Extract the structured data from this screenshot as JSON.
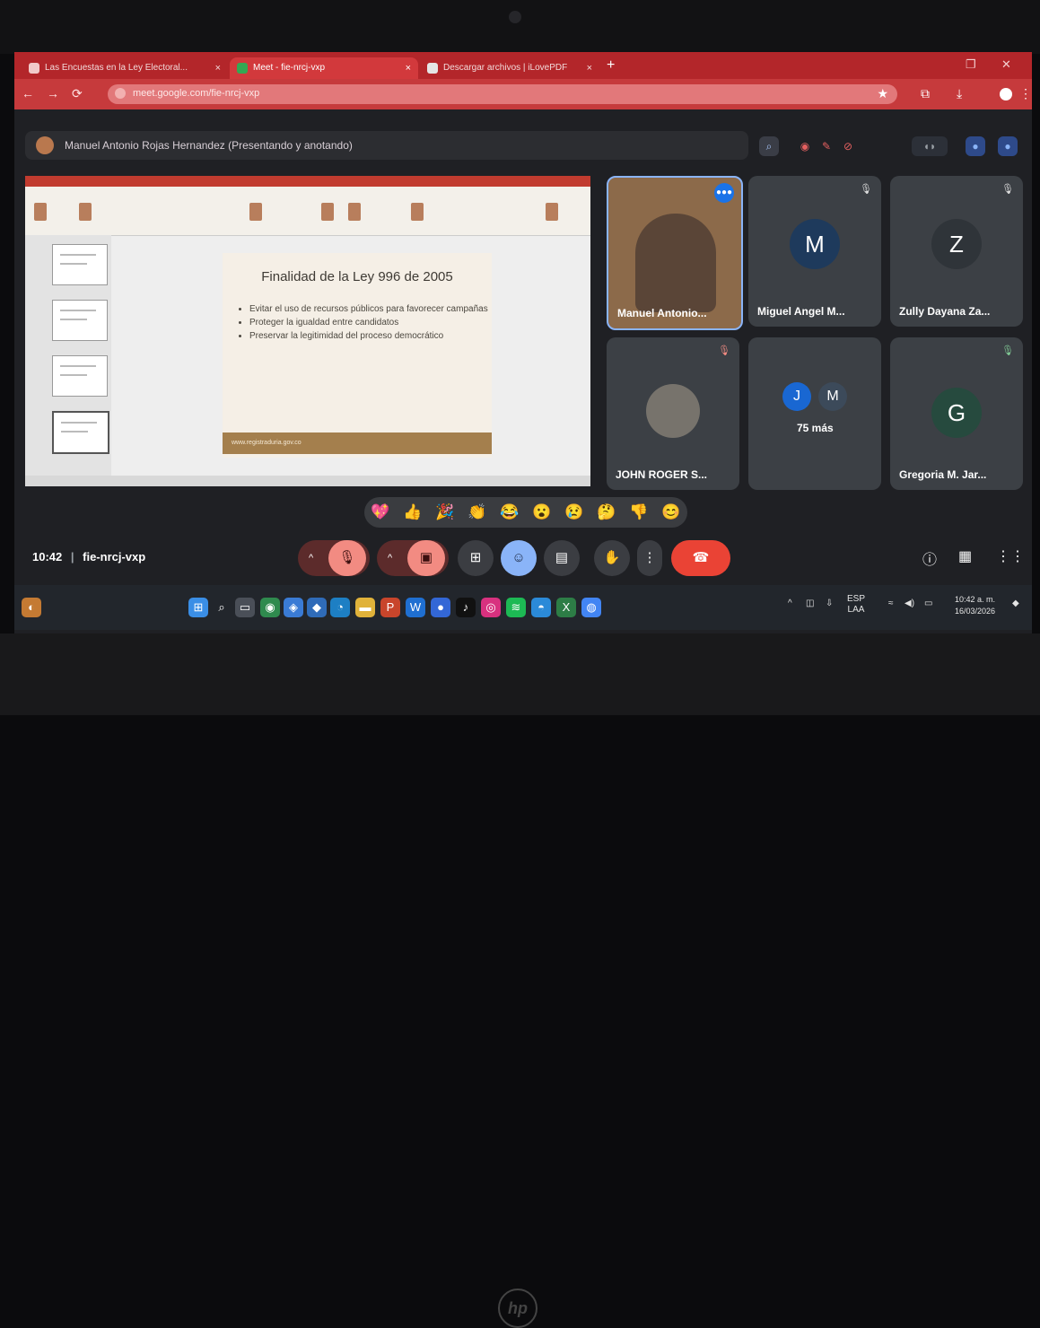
{
  "browser": {
    "tabs": [
      {
        "label": "Las Encuestas en la Ley Electoral...",
        "close": "×"
      },
      {
        "label": "Meet - fie-nrcj-vxp",
        "close": "×"
      },
      {
        "label": "Descargar archivos | iLovePDF",
        "close": "×"
      }
    ],
    "new_tab": "+",
    "url": "meet.google.com/fie-nrcj-vxp"
  },
  "meet": {
    "presenter_text": "Manuel Antonio Rojas Hernandez (Presentando y anotando)",
    "slide": {
      "title": "Finalidad de la Ley 996 de 2005",
      "bullets": [
        "Evitar el uso de recursos públicos para favorecer campañas",
        "Proteger la igualdad entre candidatos",
        "Preservar la legitimidad del proceso democrático"
      ],
      "footer": "www.registraduria.gov.co"
    },
    "participants": [
      {
        "name": "Manuel Antonio..."
      },
      {
        "name": "Miguel Angel M...",
        "initial": "M",
        "color": "#1e3a5c"
      },
      {
        "name": "Zully Dayana Za...",
        "initial": "Z",
        "color": "#2f3439"
      },
      {
        "name": "JOHN ROGER S..."
      },
      {
        "name": "Gregoria M. Jar...",
        "initial": "G",
        "color": "#264a3e"
      }
    ],
    "more": {
      "initials": [
        "J",
        "M"
      ],
      "label": "75 más"
    },
    "reactions": [
      "💖",
      "👍",
      "🎉",
      "👏",
      "😂",
      "😮",
      "😢",
      "🤔",
      "👎",
      "😊"
    ],
    "time": "10:42",
    "meeting_code": "fie-nrcj-vxp",
    "separator": "|"
  },
  "taskbar": {
    "language": "ESP",
    "layout": "LAA",
    "time": "10:42 a. m.",
    "date": "16/03/2026"
  }
}
